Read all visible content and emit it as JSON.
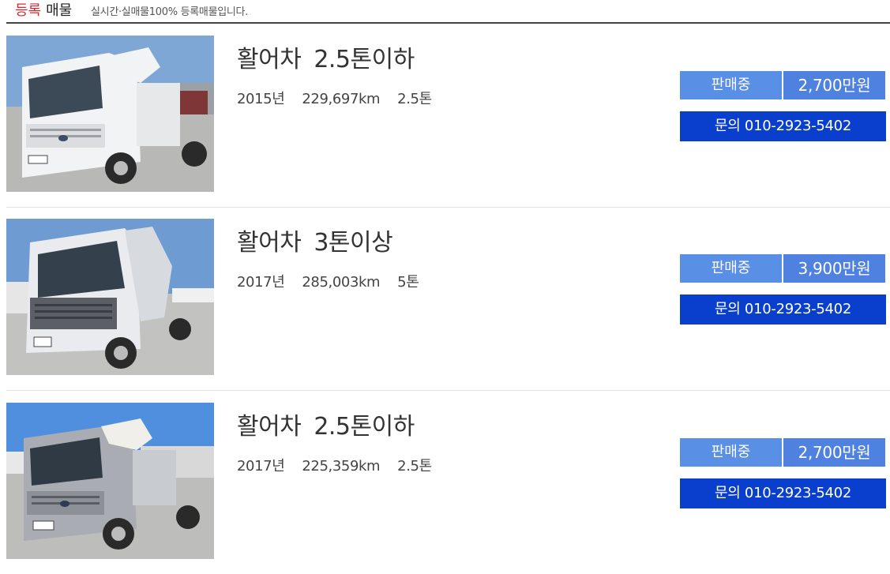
{
  "header": {
    "title_accent": "등록",
    "title_main": "매물",
    "subtitle": "실시간·실매물100% 등록매물입니다."
  },
  "listings": [
    {
      "category": "활어차",
      "tonnage_class": "2.5톤이하",
      "year": "2015년",
      "mileage": "229,697km",
      "tonnage": "2.5톤",
      "status": "판매중",
      "price": "2,700만원",
      "contact": "문의 010-2923-5402",
      "truck_color": "#f2f3f4"
    },
    {
      "category": "활어차",
      "tonnage_class": "3톤이상",
      "year": "2017년",
      "mileage": "285,003km",
      "tonnage": "5톤",
      "status": "판매중",
      "price": "3,900만원",
      "contact": "문의 010-2923-5402",
      "truck_color": "#e9ebee"
    },
    {
      "category": "활어차",
      "tonnage_class": "2.5톤이하",
      "year": "2017년",
      "mileage": "225,359km",
      "tonnage": "2.5톤",
      "status": "판매중",
      "price": "2,700만원",
      "contact": "문의 010-2923-5402",
      "truck_color": "#a9adb3"
    }
  ],
  "colors": {
    "accent_red": "#d8282d",
    "status_blue": "#5a8fe6",
    "contact_blue": "#0a3fce"
  }
}
